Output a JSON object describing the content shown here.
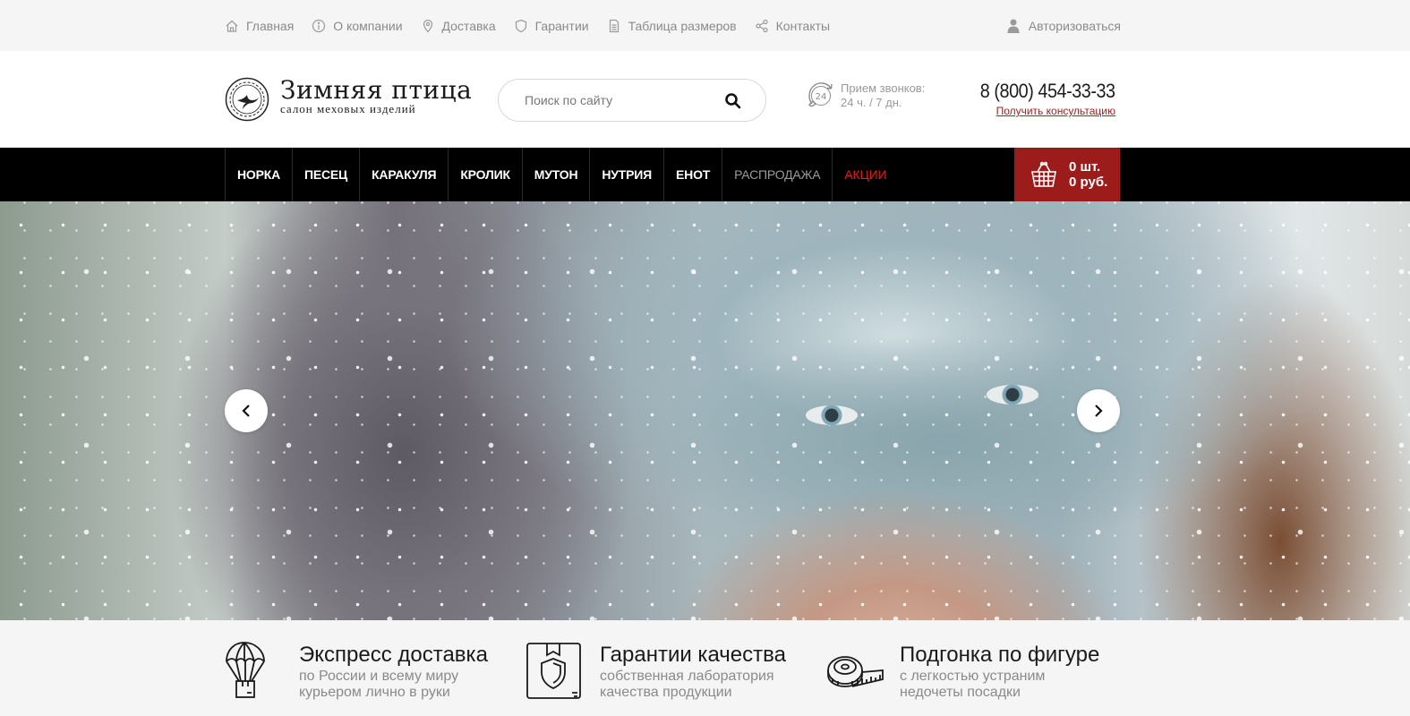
{
  "top_nav": {
    "items": [
      {
        "label": "Главная",
        "icon": "home-icon"
      },
      {
        "label": "О компании",
        "icon": "info-icon"
      },
      {
        "label": "Доставка",
        "icon": "location-pin-icon"
      },
      {
        "label": "Гарантии",
        "icon": "shield-icon"
      },
      {
        "label": "Таблица размеров",
        "icon": "document-icon"
      },
      {
        "label": "Контакты",
        "icon": "share-icon"
      }
    ],
    "login_label": "Авторизоваться",
    "login_icon": "user-icon"
  },
  "header": {
    "logo_title": "Зимняя птица",
    "logo_subtitle": "салон меховых изделий",
    "search_placeholder": "Поиск по сайту",
    "hours_icon_text": "24",
    "hours_line1": "Прием звонков:",
    "hours_line2": "24 ч. / 7 дн.",
    "phone": "8 (800) 454-33-33",
    "consult_link": "Получить консультацию"
  },
  "main_menu": {
    "items": [
      "НОРКА",
      "ПЕСЕЦ",
      "КАРАКУЛЯ",
      "КРОЛИК",
      "МУТОН",
      "НУТРИЯ",
      "ЕНОТ",
      "РАСПРОДАЖА",
      "АКЦИИ"
    ],
    "colors": {
      "default": "#ffffff",
      "sale": "#9b9b9b",
      "promo": "#e02020"
    },
    "cart_count": "0 шт.",
    "cart_sum": "0 руб.",
    "cart_color": "#9c1c1c"
  },
  "hero": {
    "prev_icon": "chevron-left-icon",
    "next_icon": "chevron-right-icon"
  },
  "features": [
    {
      "icon": "parachute-box-icon",
      "title": "Экспресс доставка",
      "desc1": "по России и всему миру",
      "desc2": "курьером лично в руки"
    },
    {
      "icon": "shield-tag-icon",
      "title": "Гарантии качества",
      "desc1": "собственная лаборатория",
      "desc2": "качества продукции"
    },
    {
      "icon": "measuring-tape-icon",
      "title": "Подгонка по фигуре",
      "desc1": "с легкостью устраним",
      "desc2": "недочеты посадки"
    }
  ]
}
